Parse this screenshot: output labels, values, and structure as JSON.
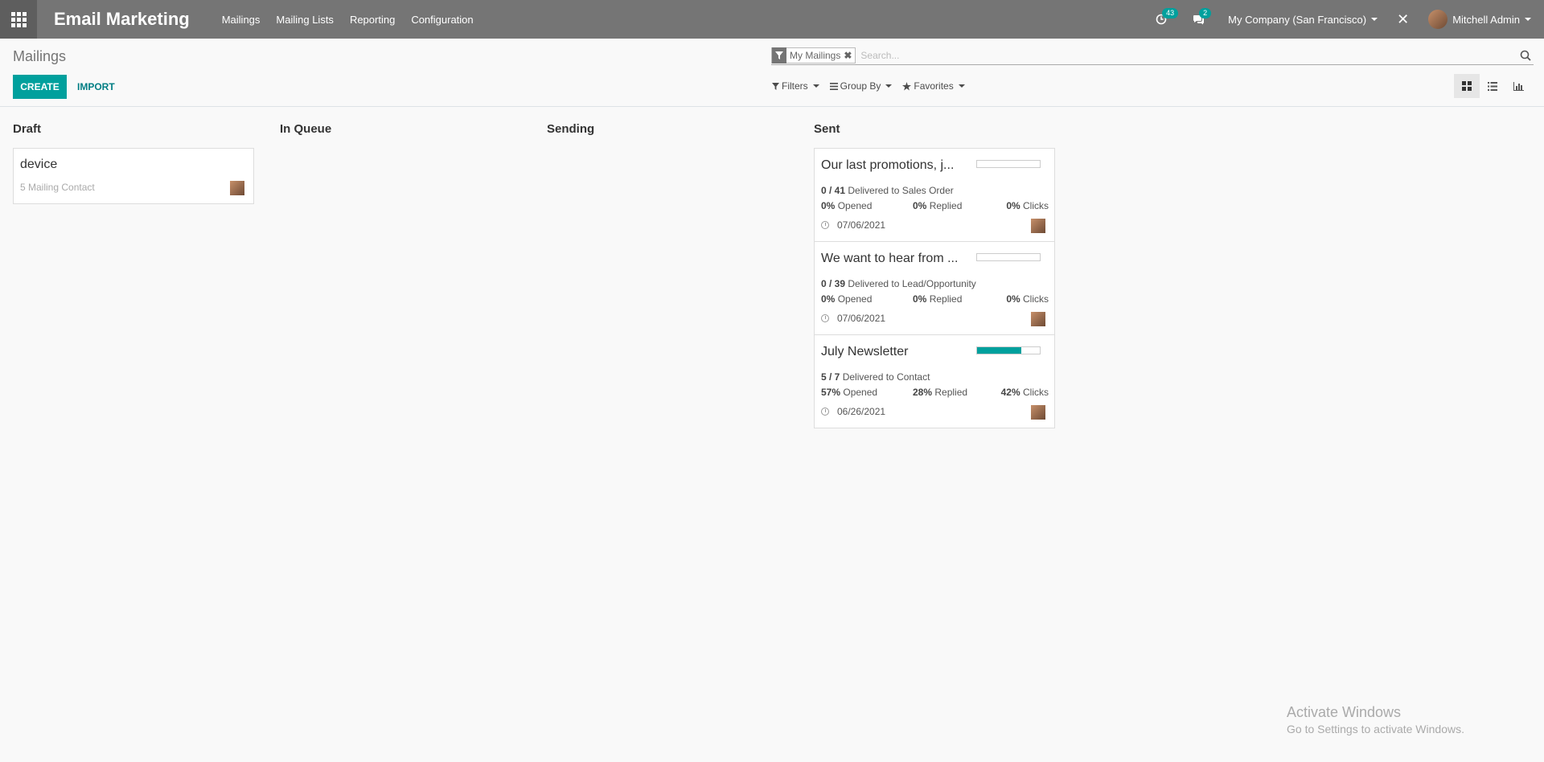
{
  "app": {
    "title": "Email Marketing",
    "menu": [
      "Mailings",
      "Mailing Lists",
      "Reporting",
      "Configuration"
    ]
  },
  "systray": {
    "activity_count": "43",
    "message_count": "2",
    "company": "My Company (San Francisco)",
    "user": "Mitchell Admin"
  },
  "control": {
    "breadcrumb": "Mailings",
    "create_label": "CREATE",
    "import_label": "IMPORT",
    "search_facet": "My Mailings",
    "search_placeholder": "Search...",
    "filters_label": "Filters",
    "groupby_label": "Group By",
    "favorites_label": "Favorites"
  },
  "kanban": {
    "columns": [
      {
        "title": "Draft",
        "cards": [
          {
            "title": "device",
            "subtitle": "5 Mailing Contact"
          }
        ]
      },
      {
        "title": "In Queue",
        "cards": []
      },
      {
        "title": "Sending",
        "cards": []
      },
      {
        "title": "Sent",
        "cards": [
          {
            "title": "Our last promotions, j...",
            "progress": 0,
            "delivered": "0 / 41",
            "delivered_to": "Delivered to Sales Order",
            "opened": "0%",
            "opened_label": "Opened",
            "replied": "0%",
            "replied_label": "Replied",
            "clicks": "0%",
            "clicks_label": "Clicks",
            "date": "07/06/2021"
          },
          {
            "title": "We want to hear from ...",
            "progress": 0,
            "delivered": "0 / 39",
            "delivered_to": "Delivered to Lead/Opportunity",
            "opened": "0%",
            "opened_label": "Opened",
            "replied": "0%",
            "replied_label": "Replied",
            "clicks": "0%",
            "clicks_label": "Clicks",
            "date": "07/06/2021"
          },
          {
            "title": "July Newsletter",
            "progress": 0.71,
            "delivered": "5 / 7",
            "delivered_to": "Delivered to Contact",
            "opened": "57%",
            "opened_label": "Opened",
            "replied": "28%",
            "replied_label": "Replied",
            "clicks": "42%",
            "clicks_label": "Clicks",
            "date": "06/26/2021"
          }
        ]
      }
    ]
  },
  "watermark": {
    "title": "Activate Windows",
    "subtitle": "Go to Settings to activate Windows."
  }
}
